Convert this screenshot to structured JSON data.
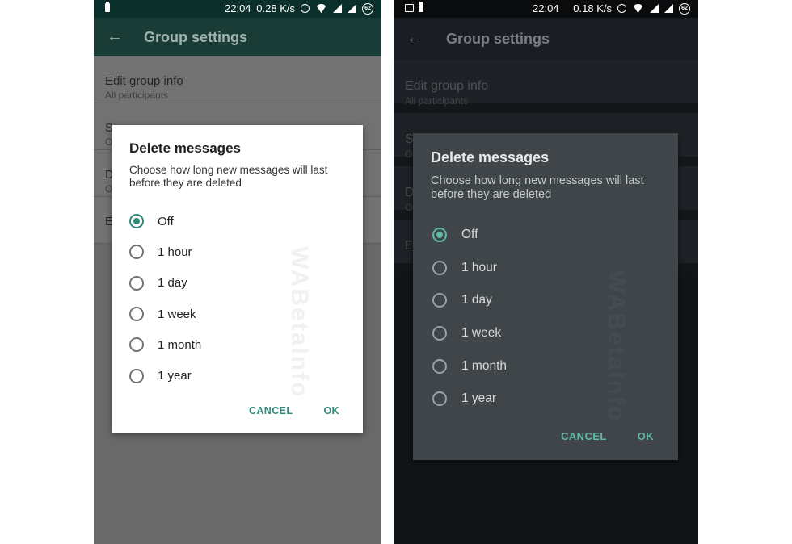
{
  "screens": [
    {
      "theme": "light",
      "status": {
        "time": "22:04",
        "speed": "0.28 K/s",
        "battery": "62"
      },
      "toolbar": {
        "title": "Group settings"
      },
      "background_items": [
        {
          "title": "Edit group info",
          "subtitle": "All participants"
        },
        {
          "title": "S",
          "subtitle": "O"
        },
        {
          "title": "D",
          "subtitle": "O"
        },
        {
          "title": "E",
          "subtitle": ""
        }
      ],
      "dialog": {
        "title": "Delete messages",
        "body": "Choose how long new messages will last before they are deleted",
        "options": [
          "Off",
          "1 hour",
          "1 day",
          "1 week",
          "1 month",
          "1 year"
        ],
        "selected_index": 0,
        "cancel": "CANCEL",
        "ok": "OK"
      },
      "watermark": "WABetaInfo"
    },
    {
      "theme": "dark",
      "status": {
        "time": "22:04",
        "speed": "0.18 K/s",
        "battery": "62"
      },
      "toolbar": {
        "title": "Group settings"
      },
      "background_items": [
        {
          "title": "Edit group info",
          "subtitle": "All participants"
        },
        {
          "title": "S",
          "subtitle": "O"
        },
        {
          "title": "D",
          "subtitle": "O"
        },
        {
          "title": "E",
          "subtitle": ""
        }
      ],
      "dialog": {
        "title": "Delete messages",
        "body": "Choose how long new messages will last before they are deleted",
        "options": [
          "Off",
          "1 hour",
          "1 day",
          "1 week",
          "1 month",
          "1 year"
        ],
        "selected_index": 0,
        "cancel": "CANCEL",
        "ok": "OK"
      },
      "watermark": "WABetaInfo"
    }
  ],
  "colors": {
    "accent_light": "#2e8b7b",
    "accent_dark": "#5fbaa8",
    "dialog_dark_bg": "#3f4549",
    "scrim_light": "#696969",
    "scrim_dark": "#121518"
  }
}
